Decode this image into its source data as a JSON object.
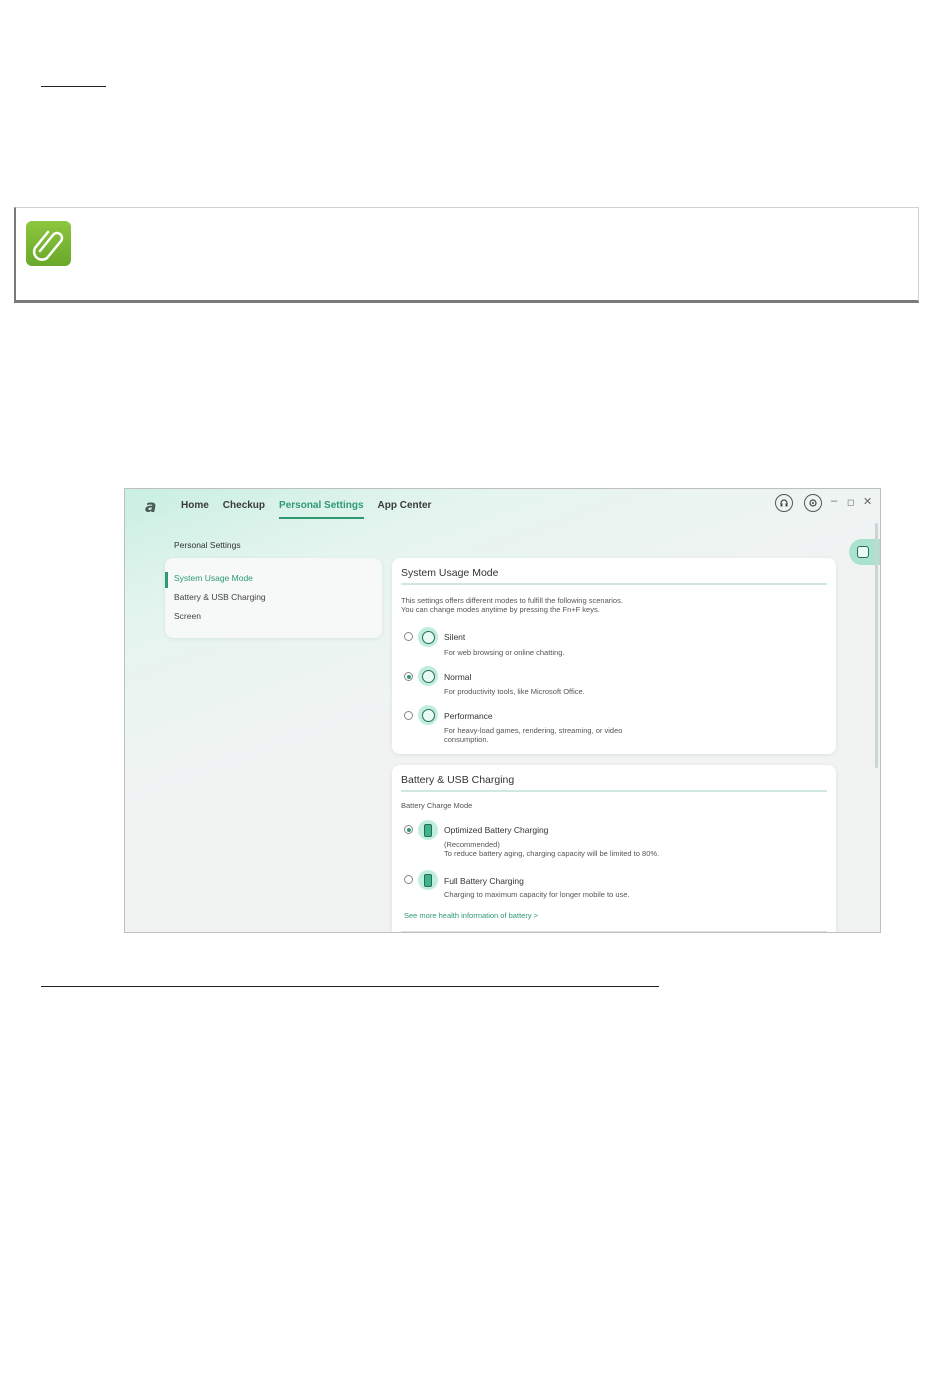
{
  "app": {
    "logo": "a",
    "nav": [
      "Home",
      "Checkup",
      "Personal Settings",
      "App Center"
    ],
    "active_nav": "Personal Settings",
    "window_controls": {
      "minimize": "–",
      "restore": "◻",
      "close": "✕"
    },
    "page_title": "Personal Settings",
    "sidebar": [
      {
        "label": "System Usage Mode",
        "active": true
      },
      {
        "label": "Battery & USB Charging",
        "active": false
      },
      {
        "label": "Screen",
        "active": false
      }
    ],
    "system_usage": {
      "title": "System Usage Mode",
      "desc1": "This settings offers different modes to fulfill the following scenarios.",
      "desc2": "You can change modes anytime by pressing the Fn+F keys.",
      "options": [
        {
          "label": "Silent",
          "desc": "For web browsing or online chatting.",
          "desc2": "",
          "selected": false,
          "icon": "moon-gauge-icon"
        },
        {
          "label": "Normal",
          "desc": "For productivity tools, like Microsoft Office.",
          "desc2": "",
          "selected": true,
          "icon": "normal-gauge-icon"
        },
        {
          "label": "Performance",
          "desc": "For heavy-load games, rendering, streaming, or video",
          "desc2": "consumption.",
          "selected": false,
          "icon": "performance-gauge-icon"
        }
      ]
    },
    "battery": {
      "title": "Battery & USB Charging",
      "subtitle": "Battery Charge Mode",
      "options": [
        {
          "label": "Optimized Battery Charging",
          "desc": "(Recommended)",
          "desc2": "To reduce battery aging, charging capacity will be limited to 80%.",
          "selected": true
        },
        {
          "label": "Full Battery Charging",
          "desc": "Charging to maximum capacity for longer mobile to use.",
          "desc2": "",
          "selected": false
        }
      ],
      "link": "See more health information of battery >"
    },
    "accent": "#2f9a70"
  }
}
